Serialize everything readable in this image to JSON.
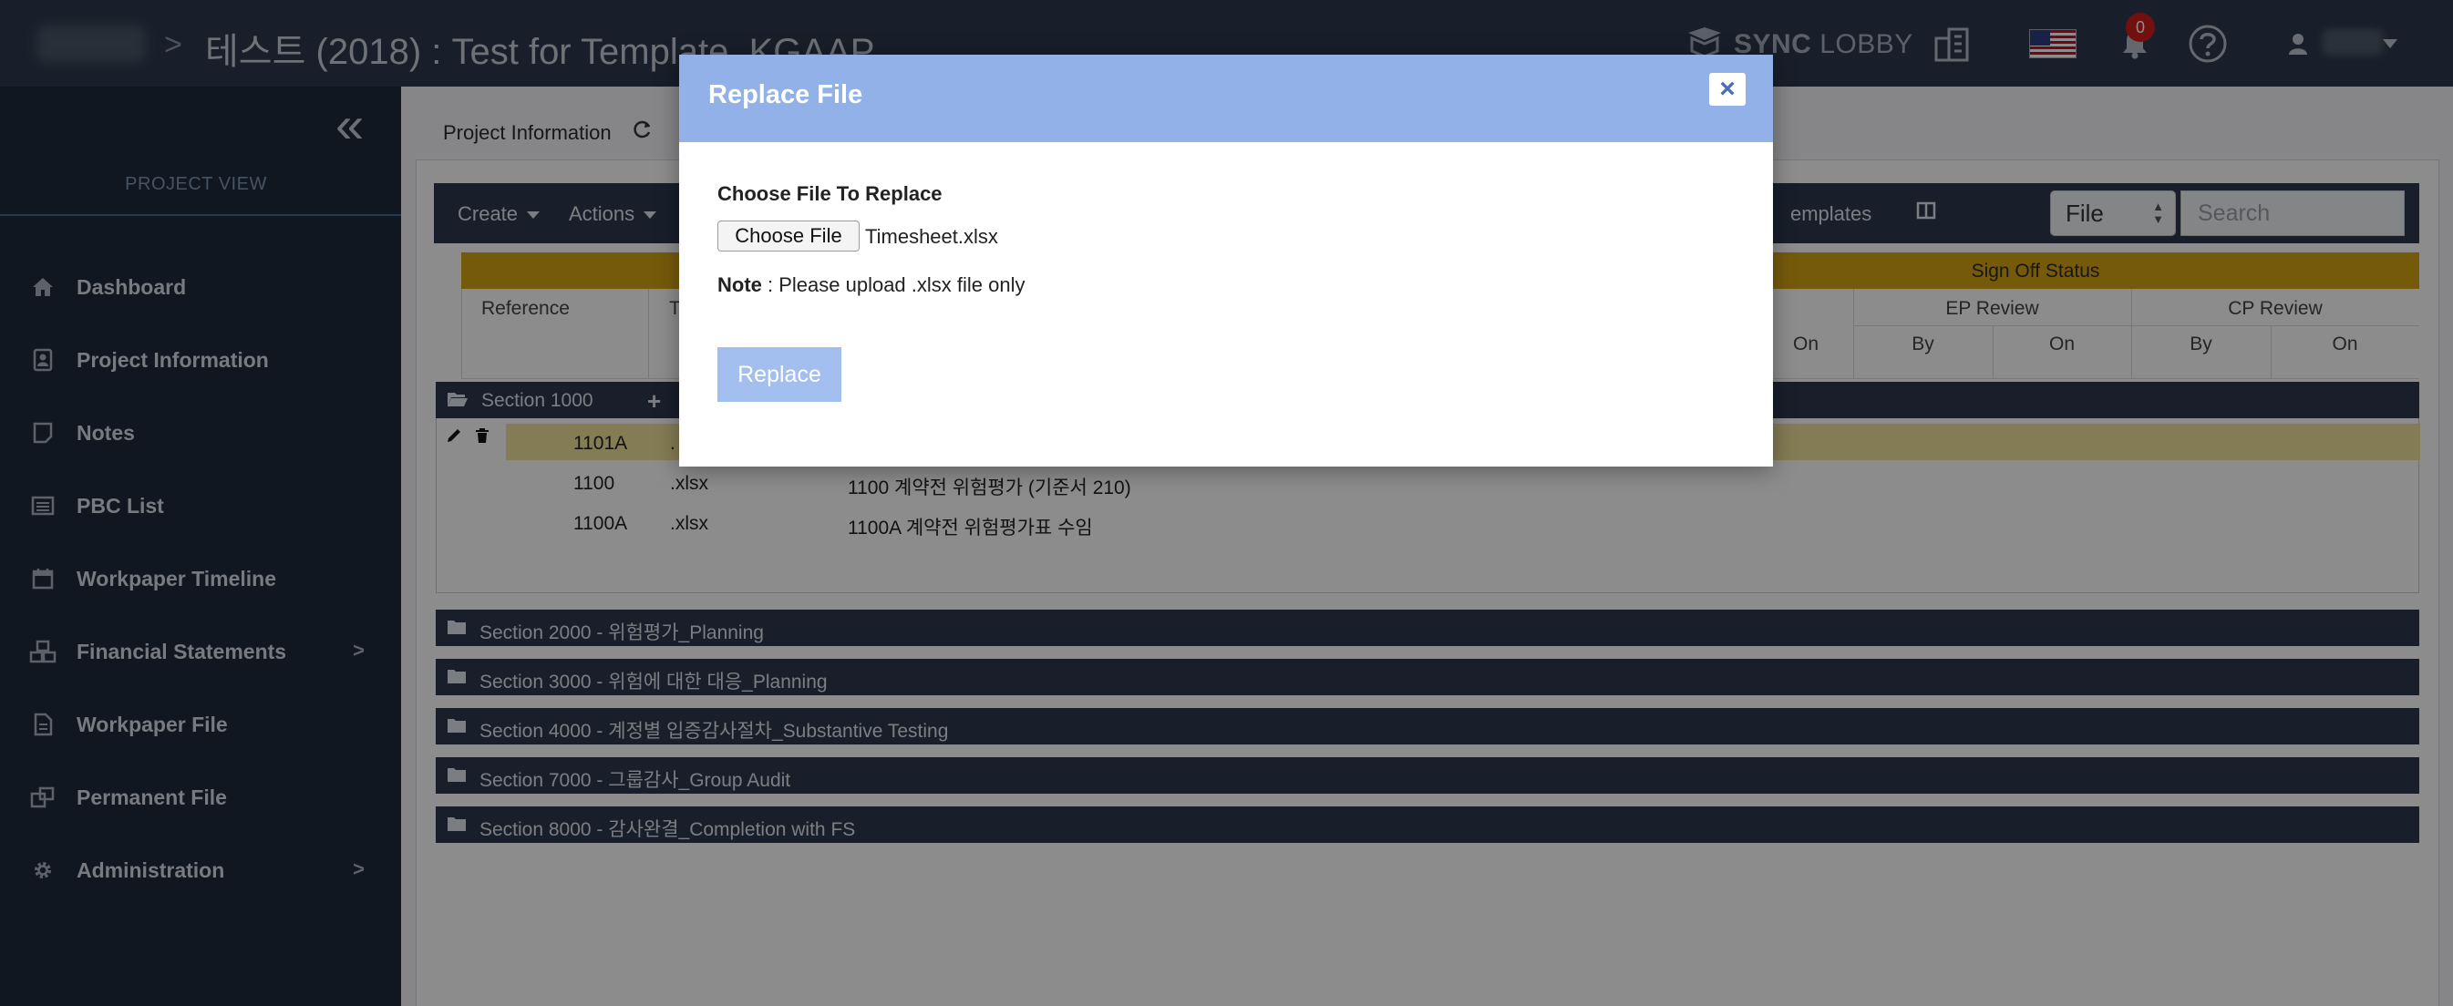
{
  "header": {
    "breadcrumb_separator": ">",
    "project_title": "테스트 (2018) : Test for Template_KGAAP",
    "sync_lobby": {
      "bold": "SYNC",
      "light": "LOBBY"
    },
    "notification_count": "0",
    "icons": [
      "sync-lobby-icon",
      "building-icon",
      "us-flag-icon",
      "bell-icon",
      "help-icon",
      "user-icon",
      "caret-down-icon"
    ]
  },
  "sidebar": {
    "view_label": "PROJECT VIEW",
    "items": [
      {
        "label": "Dashboard",
        "icon": "home-icon"
      },
      {
        "label": "Project Information",
        "icon": "contact-card-icon"
      },
      {
        "label": "Notes",
        "icon": "note-icon"
      },
      {
        "label": "PBC List",
        "icon": "list-icon"
      },
      {
        "label": "Workpaper Timeline",
        "icon": "calendar-icon"
      },
      {
        "label": "Financial Statements",
        "icon": "cubes-icon",
        "has_submenu": true
      },
      {
        "label": "Workpaper File",
        "icon": "file-icon"
      },
      {
        "label": "Permanent File",
        "icon": "copy-icon"
      },
      {
        "label": "Administration",
        "icon": "gear-icon",
        "has_submenu": true
      }
    ],
    "submenu_chevron": ">"
  },
  "main": {
    "tab_label": "Project Information",
    "toolbar": {
      "create": "Create",
      "actions": "Actions",
      "templates": "emplates",
      "file_select": "File",
      "search_placeholder": "Search"
    },
    "table_header": {
      "sign_off_status": "Sign Off Status",
      "reference": "Reference",
      "type_abbrev": "T",
      "ep_review": "EP Review",
      "cp_review": "CP Review",
      "on": "On",
      "by": "By"
    },
    "open_section": {
      "title": "Section 1000",
      "add": "+",
      "rows": [
        {
          "ref": "1101A",
          "type": ".",
          "name": ""
        },
        {
          "ref": "1100",
          "type": ".xlsx",
          "name": "1100 계약전 위험평가 (기준서 210)"
        },
        {
          "ref": "1100A",
          "type": ".xlsx",
          "name": "1100A 계약전 위험평가표 수임"
        }
      ]
    },
    "sections": [
      "Section 2000 - 위험평가_Planning",
      "Section 3000 - 위험에 대한 대응_Planning",
      "Section 4000 - 계정별 입증감사절차_Substantive Testing",
      "Section 7000 - 그룹감사_Group Audit",
      "Section 8000 - 감사완결_Completion with FS"
    ]
  },
  "modal": {
    "title": "Replace File",
    "close": "×",
    "choose_label": "Choose File To Replace",
    "choose_button": "Choose File",
    "chosen_file": "Timesheet.xlsx",
    "note_label": "Note",
    "note_text": " : Please upload .xlsx file only",
    "replace_button": "Replace"
  },
  "colors": {
    "navy": "#2d3a4e",
    "sidebar": "#1f2a3b",
    "signoff_band": "#d8a514",
    "highlight_row": "#f0e29a",
    "modal_header": "#92b1e8",
    "replace_button": "#a3bff0",
    "badge": "#d01c1c"
  }
}
